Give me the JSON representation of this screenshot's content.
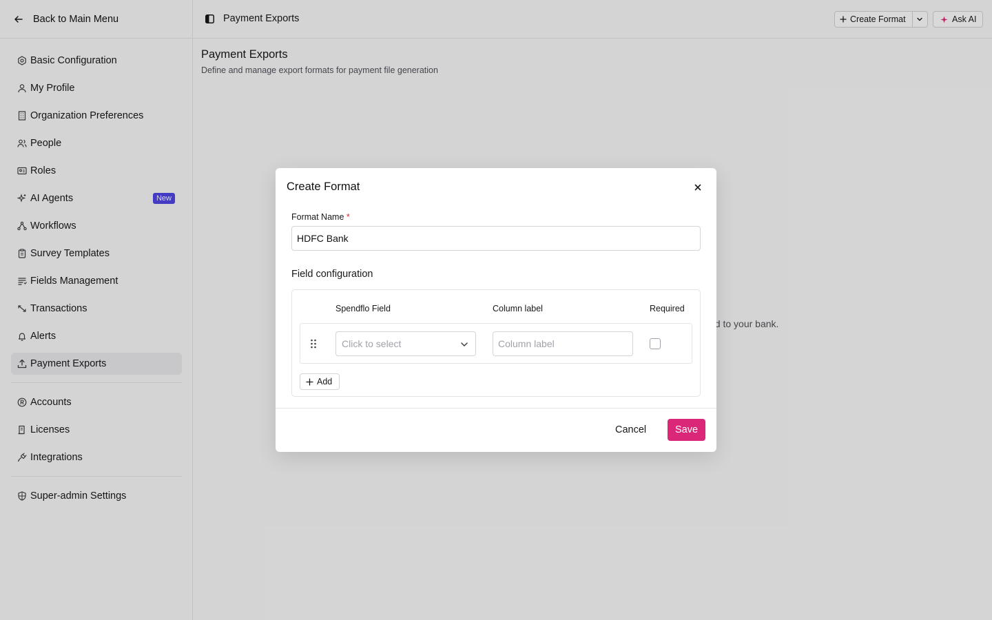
{
  "sidebar": {
    "back_label": "Back to Main Menu",
    "items": [
      {
        "label": "Basic Configuration",
        "icon": "settings-icon"
      },
      {
        "label": "My Profile",
        "icon": "user-icon"
      },
      {
        "label": "Organization Preferences",
        "icon": "building-icon"
      },
      {
        "label": "People",
        "icon": "users-icon"
      },
      {
        "label": "Roles",
        "icon": "id-card-icon"
      },
      {
        "label": "AI Agents",
        "icon": "sparkles-icon",
        "badge": "New"
      },
      {
        "label": "Workflows",
        "icon": "workflow-icon"
      },
      {
        "label": "Survey Templates",
        "icon": "clipboard-icon"
      },
      {
        "label": "Fields Management",
        "icon": "list-filter-icon"
      },
      {
        "label": "Transactions",
        "icon": "transactions-icon"
      },
      {
        "label": "Alerts",
        "icon": "bell-icon"
      },
      {
        "label": "Payment Exports",
        "icon": "upload-icon",
        "active": true
      }
    ],
    "items2": [
      {
        "label": "Accounts",
        "icon": "registered-icon"
      },
      {
        "label": "Licenses",
        "icon": "license-icon"
      },
      {
        "label": "Integrations",
        "icon": "plug-icon"
      }
    ],
    "items3": [
      {
        "label": "Super-admin Settings",
        "icon": "shield-icon"
      }
    ]
  },
  "topbar": {
    "title": "Payment Exports",
    "create_label": "Create Format",
    "ask_label": "Ask AI"
  },
  "page": {
    "title": "Payment Exports",
    "subtitle": "Define and manage export formats for payment file generation",
    "empty_fragment": "ed to your bank."
  },
  "modal": {
    "title": "Create Format",
    "format_name_label": "Format Name",
    "required_mark": "*",
    "format_name_value": "HDFC Bank",
    "field_config_title": "Field configuration",
    "columns": {
      "spendflo_field": "Spendflo Field",
      "column_label": "Column label",
      "required": "Required"
    },
    "row": {
      "select_placeholder": "Click to select",
      "column_label_placeholder": "Column label",
      "required_checked": false
    },
    "add_label": "Add",
    "cancel_label": "Cancel",
    "save_label": "Save"
  },
  "colors": {
    "accent": "#db2777",
    "badge": "#4f46e5",
    "required": "#dc2626"
  }
}
